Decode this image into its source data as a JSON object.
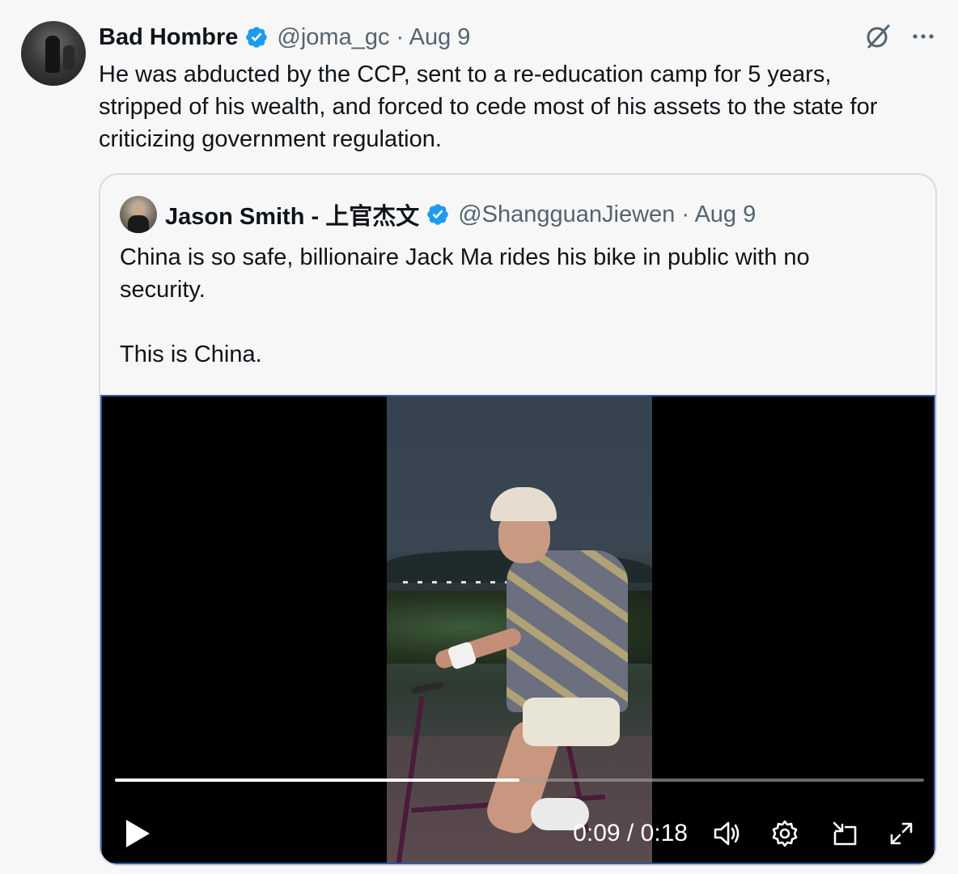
{
  "tweet": {
    "author_name": "Bad Hombre",
    "author_meta": "@joma_gc · Aug 9",
    "text": "He was abducted by the CCP, sent to a re-education camp for 5 years, stripped of his wealth, and forced to cede most of his assets to the state for criticizing government regulation."
  },
  "quoted": {
    "author_name": "Jason Smith - 上官杰文",
    "author_meta": "@ShangguanJiewen · Aug 9",
    "text_line1": "China is so safe, billionaire Jack Ma rides his bike in public with no security.",
    "text_line2": "This is China."
  },
  "video": {
    "time": "0:09 / 0:18",
    "progress": 0.5
  },
  "icons": {
    "verified": "verified-badge-icon",
    "grok": "grok-icon",
    "more": "more-icon",
    "play": "play-icon",
    "volume": "volume-icon",
    "settings": "settings-gear-icon",
    "pip": "picture-in-picture-icon",
    "fullscreen": "fullscreen-icon"
  },
  "colors": {
    "verified": "#1d9bf0",
    "meta": "#536471",
    "text": "#0f1419"
  }
}
